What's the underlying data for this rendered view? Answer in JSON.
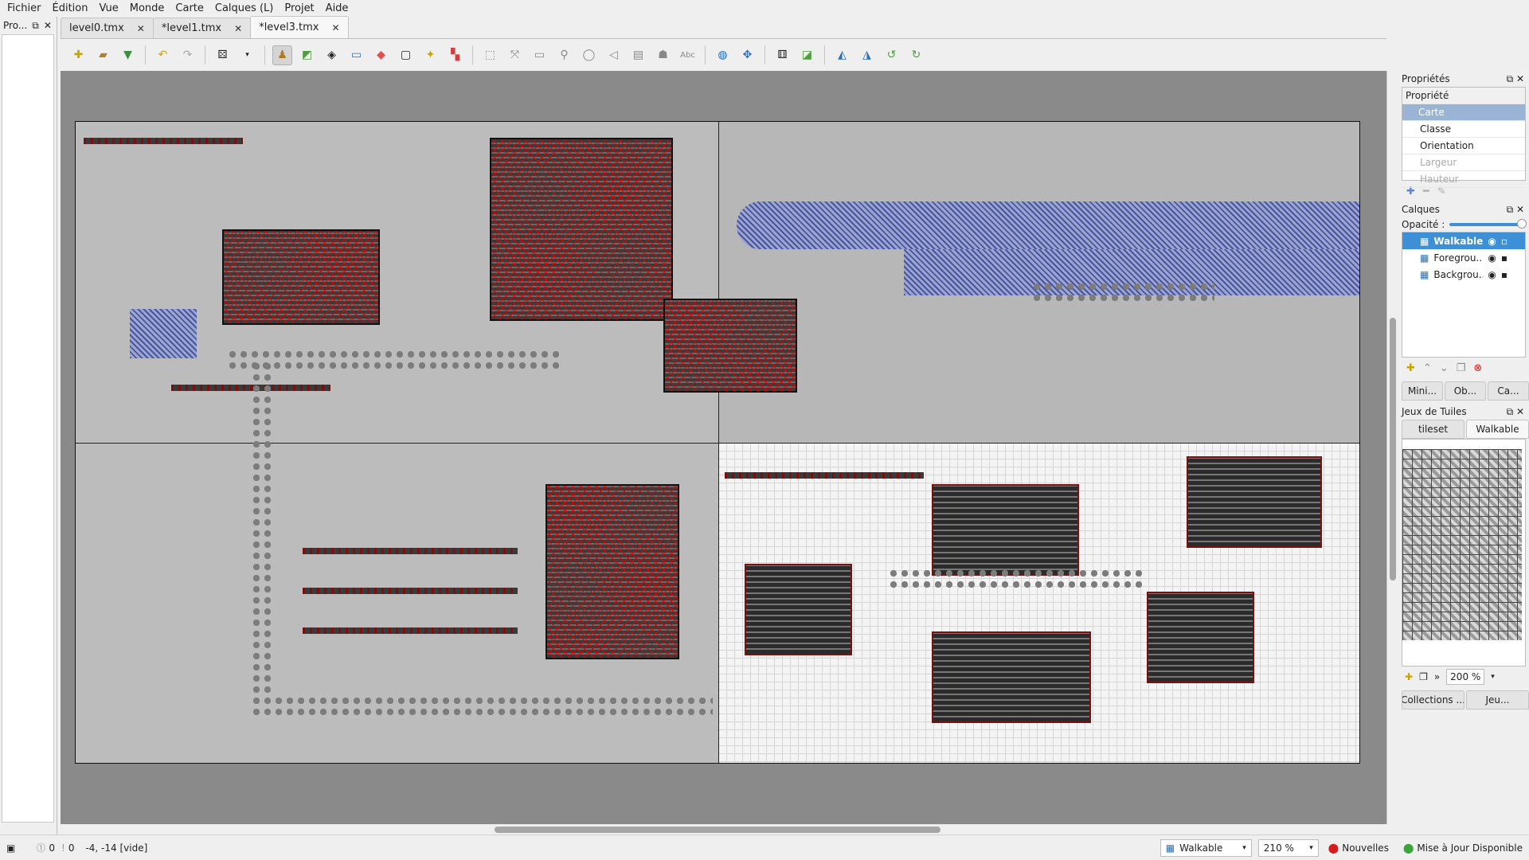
{
  "menu": [
    "Fichier",
    "Édition",
    "Vue",
    "Monde",
    "Carte",
    "Calques (L)",
    "Projet",
    "Aide"
  ],
  "left_dock": {
    "title": "Pro..."
  },
  "tabs": [
    {
      "label": "level0.tmx"
    },
    {
      "label": "*level1.tmx"
    },
    {
      "label": "*level3.tmx",
      "active": true
    }
  ],
  "properties": {
    "title": "Propriétés",
    "header": "Propriété",
    "group": "Carte",
    "rows": [
      "Classe",
      "Orientation",
      "Largeur",
      "Hauteur"
    ]
  },
  "layers": {
    "title": "Calques",
    "opacity_label": "Opacité :",
    "items": [
      {
        "name": "Walkable"
      },
      {
        "name": "Foregrou..."
      },
      {
        "name": "Backgrou..."
      }
    ],
    "bottom_tabs": [
      "Mini...",
      "Ob...",
      "Ca..."
    ]
  },
  "tilesets": {
    "title": "Jeux de Tuiles",
    "tabs": [
      "tileset",
      "Walkable"
    ],
    "zoom": "200 %",
    "bottom_tabs": [
      "Collections ...",
      "Jeu..."
    ]
  },
  "status": {
    "warn_count": "0",
    "err_count": "0",
    "coords": "-4, -14 [vide]",
    "layer": "Walkable",
    "zoom": "210 %",
    "news": "Nouvelles",
    "update": "Mise à Jour Disponible"
  }
}
